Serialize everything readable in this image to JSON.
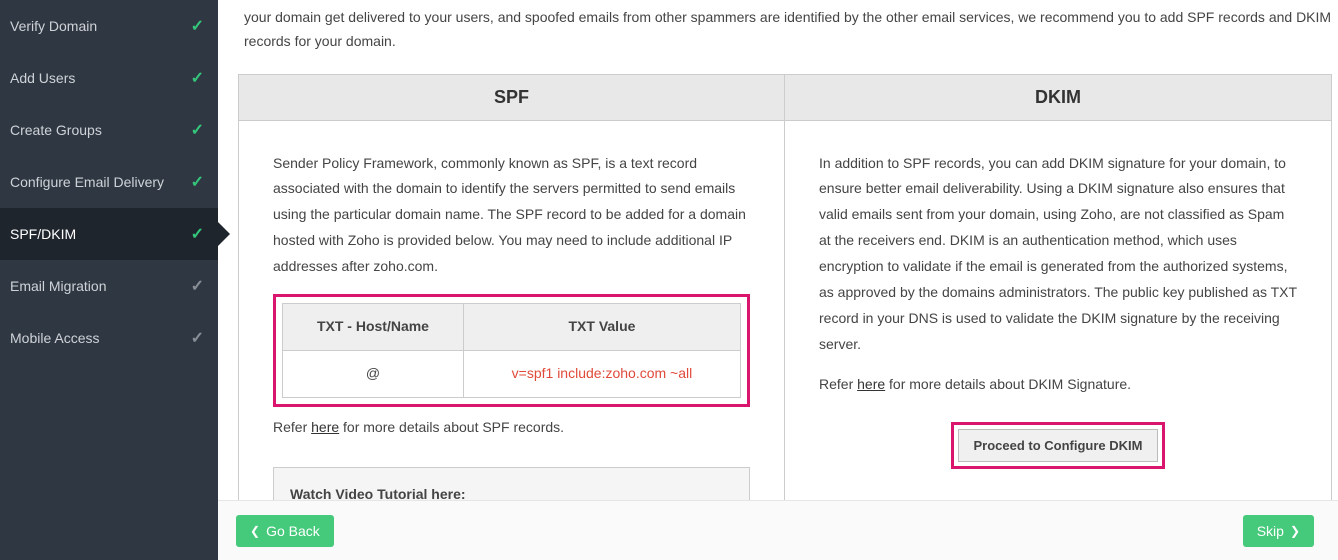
{
  "sidebar": {
    "items": [
      {
        "label": "Verify Domain",
        "done": true,
        "active": false
      },
      {
        "label": "Add Users",
        "done": true,
        "active": false
      },
      {
        "label": "Create Groups",
        "done": true,
        "active": false
      },
      {
        "label": "Configure Email Delivery",
        "done": true,
        "active": false
      },
      {
        "label": "SPF/DKIM",
        "done": true,
        "active": true
      },
      {
        "label": "Email Migration",
        "done": false,
        "active": false
      },
      {
        "label": "Mobile Access",
        "done": false,
        "active": false
      }
    ]
  },
  "intro": "your domain get delivered to your users, and spoofed emails from other spammers are identified by the other email services, we recommend you to add SPF records and DKIM records for your domain.",
  "spf": {
    "title": "SPF",
    "desc": "Sender Policy Framework, commonly known as SPF, is a text record associated with the domain to identify the servers permitted to send emails using the particular domain name. The SPF record to be added for a domain hosted with Zoho is provided below. You may need to include additional IP addresses after zoho.com.",
    "table": {
      "h1": "TXT - Host/Name",
      "h2": "TXT Value",
      "host": "@",
      "value": "v=spf1 include:zoho.com ~all"
    },
    "refer_prefix": "Refer ",
    "refer_link": "here",
    "refer_suffix": " for more details about SPF records.",
    "video": "Watch Video Tutorial here:"
  },
  "dkim": {
    "title": "DKIM",
    "desc": "In addition to SPF records, you can add DKIM signature for your domain, to ensure better email deliverability. Using a DKIM signature also ensures that valid emails sent from your domain, using Zoho, are not classified as Spam at the receivers end. DKIM is an authentication method, which uses encryption to validate if the email is generated from the authorized systems, as approved by the domains administrators. The public key published as TXT record in your DNS is used to validate the DKIM signature by the receiving server.",
    "refer_prefix": "Refer ",
    "refer_link": "here",
    "refer_suffix": " for more details about DKIM Signature.",
    "button": "Proceed to Configure DKIM"
  },
  "footer": {
    "back": "Go Back",
    "skip": "Skip"
  }
}
